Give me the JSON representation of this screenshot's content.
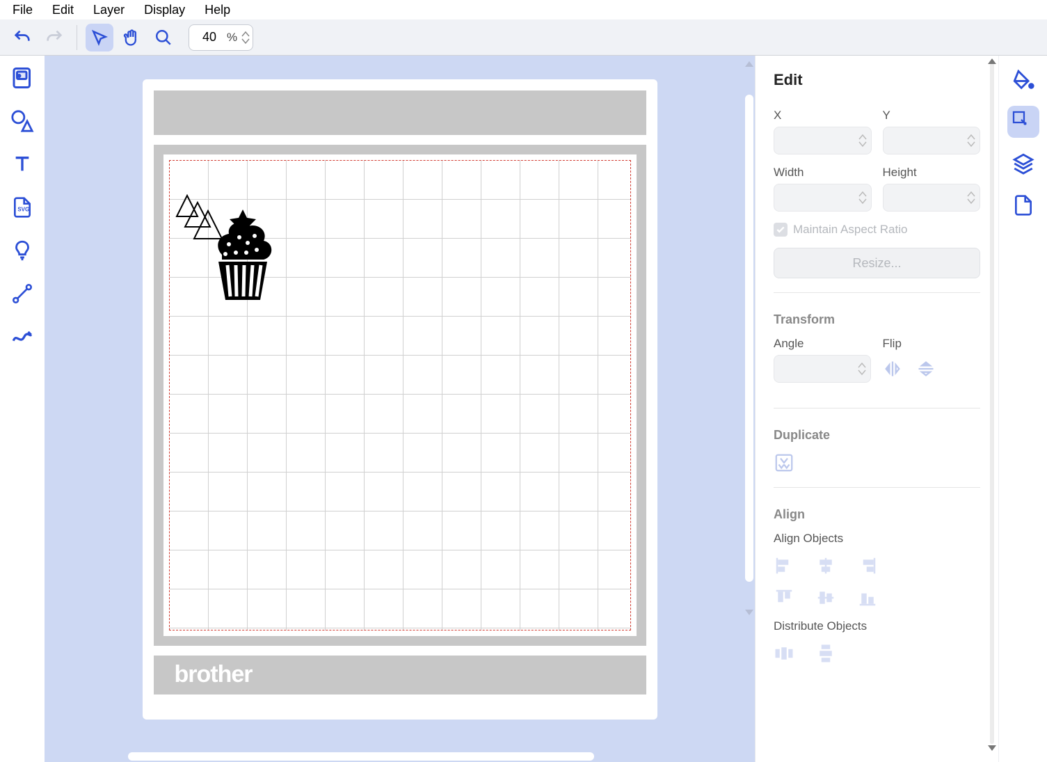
{
  "menu": {
    "items": [
      "File",
      "Edit",
      "Layer",
      "Display",
      "Help"
    ]
  },
  "toolbar": {
    "zoom_value": "40",
    "zoom_unit": "%"
  },
  "right_panel": {
    "title": "Edit",
    "pos": {
      "x_label": "X",
      "y_label": "Y",
      "w_label": "Width",
      "h_label": "Height"
    },
    "maintain_aspect": "Maintain Aspect Ratio",
    "resize_btn": "Resize...",
    "transform": {
      "title": "Transform",
      "angle_label": "Angle",
      "flip_label": "Flip"
    },
    "duplicate": {
      "title": "Duplicate"
    },
    "align": {
      "title": "Align",
      "objects_label": "Align Objects",
      "distribute_label": "Distribute Objects"
    }
  },
  "brand": "brother"
}
